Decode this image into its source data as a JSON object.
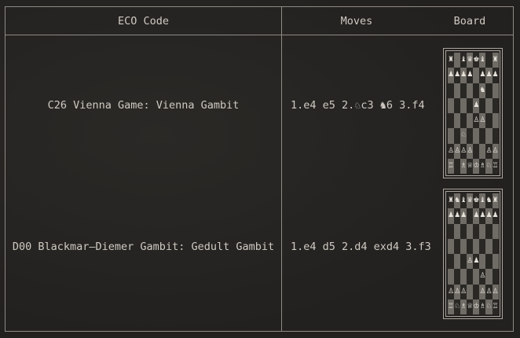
{
  "table": {
    "headers": [
      "ECO Code",
      "Moves",
      "Board"
    ],
    "rows": [
      {
        "eco": "C26 Vienna Game: Vienna Gambit",
        "moves": "1.e4 e5 2.♘c3 ♞6 3.f4",
        "board": [
          "♜ ♝♛♚♝ ♜",
          "♟♟♟♟ ♟♟♟",
          "     ♞  ",
          "    ♟   ",
          "    ♙♙  ",
          "  ♘     ",
          "♙♙♙♙  ♙♙",
          "♖ ♗♕♔♗♘♖"
        ]
      },
      {
        "eco": "D00 Blackmar–Diemer Gambit: Gedult Gambit",
        "moves": "1.e4 d5 2.d4 exd4 3.f3",
        "board": [
          "♜♞♝♛♚♝♞♜",
          "♟♟♟ ♟♟♟♟",
          "        ",
          "        ",
          "   ♙♟   ",
          "     ♙  ",
          "♙♙♙  ♙♙♙",
          "♖♘♗♕♔♗♘♖"
        ]
      }
    ]
  }
}
